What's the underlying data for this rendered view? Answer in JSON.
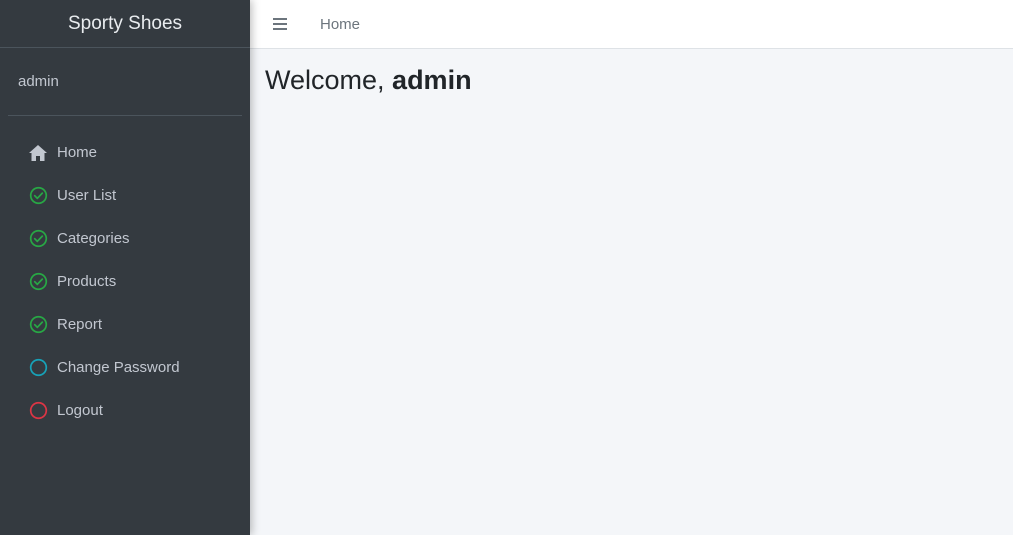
{
  "sidebar": {
    "brand": "Sporty Shoes",
    "user": "admin",
    "items": [
      {
        "label": "Home",
        "icon": "home-icon",
        "color": "#c2c7d0"
      },
      {
        "label": "User List",
        "icon": "check-circle-icon",
        "color": "#28a745"
      },
      {
        "label": "Categories",
        "icon": "check-circle-icon",
        "color": "#28a745"
      },
      {
        "label": "Products",
        "icon": "check-circle-icon",
        "color": "#28a745"
      },
      {
        "label": "Report",
        "icon": "check-circle-icon",
        "color": "#28a745"
      },
      {
        "label": "Change Password",
        "icon": "circle-icon",
        "color": "#17a2b8"
      },
      {
        "label": "Logout",
        "icon": "circle-icon",
        "color": "#dc3545"
      }
    ]
  },
  "topbar": {
    "menu_icon": "hamburger-icon",
    "home_link": "Home"
  },
  "main": {
    "welcome_prefix": "Welcome, ",
    "welcome_user": "admin"
  }
}
